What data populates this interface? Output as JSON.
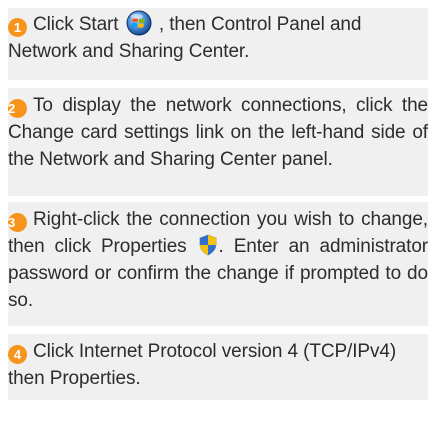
{
  "steps": [
    {
      "number": "1",
      "text_before_icon": "Click Start ",
      "icon": "windows-start-orb-icon",
      "text_after_icon": " , then Control Panel and Network and Sharing Center."
    },
    {
      "number": "2",
      "text": "To display the network connections, click the Change card settings link on the left-hand side of the Network and Sharing Center panel."
    },
    {
      "number": "3",
      "text_before_icon": "Right-click the connection you wish to change, then click Properties ",
      "icon": "uac-shield-icon",
      "text_after_icon": ". Enter an administrator password or confirm the change if prompted to do so."
    },
    {
      "number": "4",
      "text": "Click Internet Protocol version 4 (TCP/IPv4) then Properties."
    }
  ],
  "colors": {
    "panel_background": "#f0f0f0",
    "number_badge": "#f7941d",
    "text": "#2d2d2d"
  }
}
